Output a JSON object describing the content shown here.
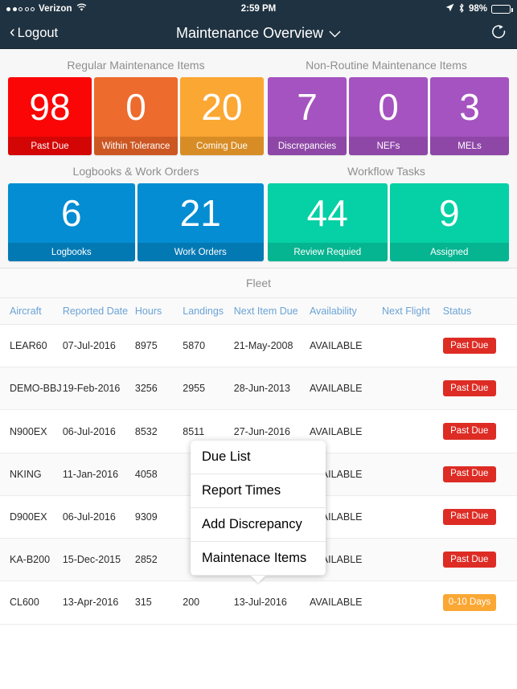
{
  "status_bar": {
    "carrier": "Verizon",
    "signal_filled_dots": 2,
    "signal_empty_dots": 3,
    "wifi_icon": "wifi-icon",
    "time": "2:59 PM",
    "location_icon": "location-arrow-icon",
    "bluetooth_icon": "bluetooth-icon",
    "battery_percent": "98%",
    "battery_level": 98
  },
  "nav_bar": {
    "back_label": "Logout",
    "back_icon": "chevron-left-icon",
    "title": "Maintenance Overview",
    "title_caret_icon": "chevron-down-icon",
    "refresh_icon": "refresh-icon",
    "background": "#1f3241"
  },
  "dashboard": {
    "groups": [
      {
        "title": "Regular Maintenance Items",
        "tiles": [
          {
            "value": "98",
            "label": "Past Due",
            "color": "#fb0606",
            "footer_color": "#d40505"
          },
          {
            "value": "0",
            "label": "Within Tolerance",
            "color": "#ed6b2d",
            "footer_color": "#cc5722"
          },
          {
            "value": "20",
            "label": "Coming Due",
            "color": "#fba733",
            "footer_color": "#d88c25"
          }
        ]
      },
      {
        "title": "Non-Routine Maintenance Items",
        "tiles": [
          {
            "value": "7",
            "label": "Discrepancies",
            "color": "#a553c0",
            "footer_color": "#8e47a7"
          },
          {
            "value": "0",
            "label": "NEFs",
            "color": "#a553c0",
            "footer_color": "#8e47a7"
          },
          {
            "value": "3",
            "label": "MELs",
            "color": "#a553c0",
            "footer_color": "#8e47a7"
          }
        ]
      },
      {
        "title": "Logbooks & Work Orders",
        "tiles": [
          {
            "value": "6",
            "label": "Logbooks",
            "color": "#048dd2",
            "footer_color": "#0379b4"
          },
          {
            "value": "21",
            "label": "Work Orders",
            "color": "#048dd2",
            "footer_color": "#0379b4"
          }
        ]
      },
      {
        "title": "Workflow Tasks",
        "tiles": [
          {
            "value": "44",
            "label": "Review Requied",
            "color": "#06d0a5",
            "footer_color": "#05b490"
          },
          {
            "value": "9",
            "label": "Assigned",
            "color": "#06d0a5",
            "footer_color": "#05b490"
          }
        ]
      }
    ]
  },
  "fleet": {
    "title": "Fleet",
    "columns": [
      "Aircraft",
      "Reported Date",
      "Hours",
      "Landings",
      "Next Item Due",
      "Availability",
      "Next Flight",
      "Status"
    ],
    "rows": [
      {
        "aircraft": "LEAR60",
        "reported_date": "07-Jul-2016",
        "hours": "8975",
        "landings": "5870",
        "next_item_due": "21-May-2008",
        "availability": "AVAILABLE",
        "next_flight": "",
        "status": "Past Due",
        "status_color": "#dd2c24"
      },
      {
        "aircraft": "DEMO-BBJ",
        "reported_date": "19-Feb-2016",
        "hours": "3256",
        "landings": "2955",
        "next_item_due": "28-Jun-2013",
        "availability": "AVAILABLE",
        "next_flight": "",
        "status": "Past Due",
        "status_color": "#dd2c24"
      },
      {
        "aircraft": "N900EX",
        "reported_date": "06-Jul-2016",
        "hours": "8532",
        "landings": "8511",
        "next_item_due": "27-Jun-2016",
        "availability": "AVAILABLE",
        "next_flight": "",
        "status": "Past Due",
        "status_color": "#dd2c24"
      },
      {
        "aircraft": "NKING",
        "reported_date": "11-Jan-2016",
        "hours": "4058",
        "landings": "",
        "next_item_due": "",
        "availability": "AVAILABLE",
        "next_flight": "",
        "status": "Past Due",
        "status_color": "#dd2c24"
      },
      {
        "aircraft": "D900EX",
        "reported_date": "06-Jul-2016",
        "hours": "9309",
        "landings": "",
        "next_item_due": "",
        "availability": "AVAILABLE",
        "next_flight": "",
        "status": "Past Due",
        "status_color": "#dd2c24"
      },
      {
        "aircraft": "KA-B200",
        "reported_date": "15-Dec-2015",
        "hours": "2852",
        "landings": "",
        "next_item_due": "",
        "availability": "AVAILABLE",
        "next_flight": "",
        "status": "Past Due",
        "status_color": "#dd2c24"
      },
      {
        "aircraft": "CL600",
        "reported_date": "13-Apr-2016",
        "hours": "315",
        "landings": "200",
        "next_item_due": "13-Jul-2016",
        "availability": "AVAILABLE",
        "next_flight": "",
        "status": "0-10 Days",
        "status_color": "#fba733"
      }
    ]
  },
  "popover": {
    "items": [
      {
        "label": "Due List"
      },
      {
        "label": "Report Times"
      },
      {
        "label": "Add Discrepancy"
      },
      {
        "label": "Maintenace Items"
      }
    ]
  }
}
